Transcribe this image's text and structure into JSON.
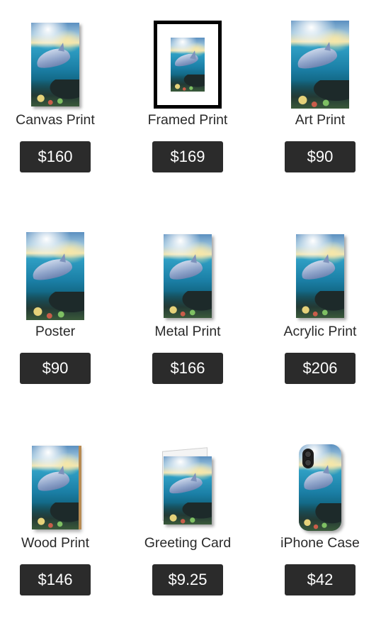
{
  "products": [
    {
      "label": "Canvas Print",
      "price": "$160"
    },
    {
      "label": "Framed Print",
      "price": "$169"
    },
    {
      "label": "Art Print",
      "price": "$90"
    },
    {
      "label": "Poster",
      "price": "$90"
    },
    {
      "label": "Metal Print",
      "price": "$166"
    },
    {
      "label": "Acrylic Print",
      "price": "$206"
    },
    {
      "label": "Wood Print",
      "price": "$146"
    },
    {
      "label": "Greeting Card",
      "price": "$9.25"
    },
    {
      "label": "iPhone Case",
      "price": "$42"
    }
  ],
  "colors": {
    "price_bg": "#2b2b2b",
    "price_text": "#ffffff",
    "label_text": "#2a2a2a"
  }
}
